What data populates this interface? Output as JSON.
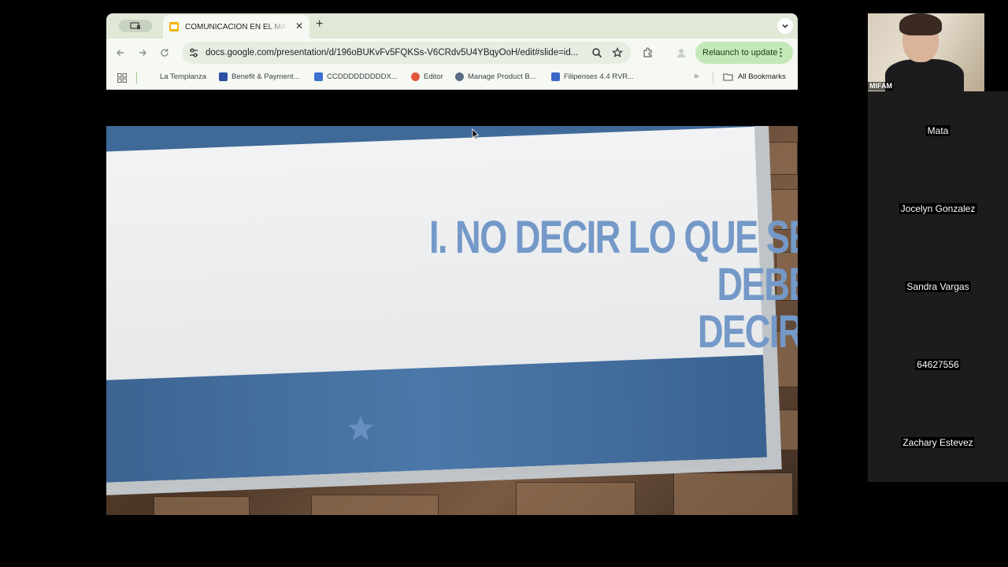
{
  "browser": {
    "tab_title": "COMUNICACIÓN EN EL MATRIMONIO",
    "url": "docs.google.com/presentation/d/196oBUKvFv5FQKSs-V6CRdv5U4YBqyOoH/edit#slide=id...",
    "relaunch_label": "Relaunch to update",
    "bookmarks": [
      {
        "label": "La Templanza",
        "color": "#ffffff"
      },
      {
        "label": "Benefit & Payment...",
        "color": "#2c4fa3"
      },
      {
        "label": "CCDDDDDDDDDX...",
        "color": "#3b6fd1"
      },
      {
        "label": "Editor",
        "color": "#e0563a"
      },
      {
        "label": "Manage Product B...",
        "color": "#5b6b86"
      },
      {
        "label": "Filipenses 4.4 RVR...",
        "color": "#3a66c8"
      }
    ],
    "all_bookmarks_label": "All Bookmarks"
  },
  "slide": {
    "title_line1": "I. NO DECIR LO QUE SE DEBE",
    "title_line2": "DECIR."
  },
  "meeting": {
    "self_label": "MIFAM",
    "participants": [
      "Mata",
      "Jocelyn Gonzalez",
      "Sandra Vargas",
      "64627556",
      "Zachary Estevez"
    ]
  }
}
